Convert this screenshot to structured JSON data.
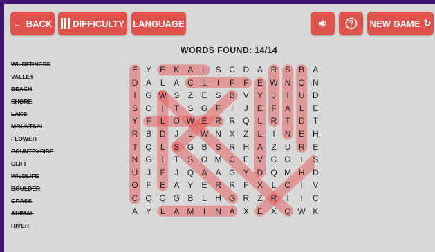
{
  "toolbar": {
    "back_label": "BACK",
    "difficulty_label": "DIFFICULTY",
    "language_label": "LANGUAGE",
    "new_game_label": "NEW GAME"
  },
  "icons": {
    "back": "arrow-left-icon",
    "difficulty": "bars-icon",
    "sound": "speaker-icon",
    "help": "question-circle-icon",
    "new_game": "refresh-icon"
  },
  "colors": {
    "accent": "#e0524c",
    "highlight": "#e8595a",
    "background": "#d8d8d8",
    "frame": "#3d1470"
  },
  "status": {
    "words_found": "WORDS FOUND: 14/14"
  },
  "words": [
    {
      "word": "WILDERNESS",
      "found": true
    },
    {
      "word": "VALLEY",
      "found": true
    },
    {
      "word": "BEACH",
      "found": true
    },
    {
      "word": "SHORE",
      "found": true
    },
    {
      "word": "LAKE",
      "found": true
    },
    {
      "word": "MOUNTAIN",
      "found": true
    },
    {
      "word": "FLOWER",
      "found": true
    },
    {
      "word": "COUNTRYSIDE",
      "found": true
    },
    {
      "word": "CLIFF",
      "found": true
    },
    {
      "word": "WILDLIFE",
      "found": true
    },
    {
      "word": "BOULDER",
      "found": true
    },
    {
      "word": "GRASS",
      "found": true
    },
    {
      "word": "ANIMAL",
      "found": true
    },
    {
      "word": "RIVER",
      "found": true
    }
  ],
  "grid": [
    "EYEKALSCDARSBA",
    "DALACLIFFEWNON",
    "IGWSZESBVYJIUD",
    "SOITSGFIJEFALE",
    "YFLOWERRQLRTDT",
    "RBDJLWNXZLINEH",
    "TQLSGBSRHAZURE",
    "NGITSOMCEVCOIS",
    "UJFJQAAGYDQMHD",
    "OFEAYERRFXLOIV",
    "CQQGBLHGRZRIIC",
    "AYLAMINAXEXQWK"
  ],
  "found_paths": [
    {
      "word": "VALLEY",
      "from": [
        0,
        11
      ],
      "to": [
        5,
        11
      ]
    },
    {
      "word": "LAKE",
      "from": [
        0,
        5
      ],
      "to": [
        0,
        2
      ]
    },
    {
      "word": "ANIMAL",
      "from": [
        11,
        7
      ],
      "to": [
        11,
        2
      ]
    },
    {
      "word": "BOULDER",
      "from": [
        0,
        12
      ],
      "to": [
        6,
        12
      ]
    },
    {
      "word": "RIVER",
      "from": [
        0,
        10
      ],
      "to": [
        4,
        10
      ]
    },
    {
      "word": "FLOWER",
      "from": [
        4,
        1
      ],
      "to": [
        4,
        6
      ]
    },
    {
      "word": "CLIFF",
      "from": [
        1,
        4
      ],
      "to": [
        1,
        8
      ]
    },
    {
      "word": "COUNTRYSIDE",
      "from": [
        10,
        0
      ],
      "to": [
        0,
        0
      ]
    },
    {
      "word": "WILDLIFE",
      "from": [
        2,
        2
      ],
      "to": [
        9,
        2
      ]
    },
    {
      "word": "MOUNTAIN",
      "from": [
        1,
        9
      ],
      "to": [
        8,
        9
      ]
    },
    {
      "word": "WILDERNESS",
      "from": [
        2,
        2
      ],
      "to": [
        11,
        11
      ]
    },
    {
      "word": "SHORE",
      "from": [
        7,
        13
      ],
      "to": [
        11,
        9
      ]
    },
    {
      "word": "GRASS",
      "from": [
        10,
        7
      ],
      "to": [
        6,
        3
      ]
    },
    {
      "word": "BEACH",
      "from": [
        2,
        7
      ],
      "to": [
        6,
        3
      ]
    }
  ]
}
